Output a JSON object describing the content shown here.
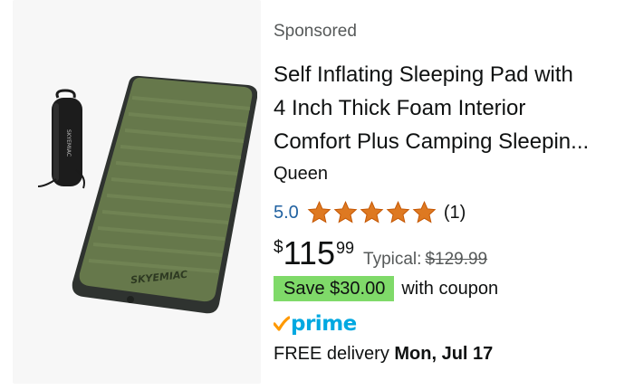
{
  "sponsored_label": "Sponsored",
  "product": {
    "title_lines": [
      "Self Inflating Sleeping Pad with",
      "4 Inch Thick Foam Interior",
      "Comfort Plus Camping Sleepin..."
    ],
    "variant": "Queen",
    "brand_on_product": "SKYEMIAC",
    "image_alt_icon": "sleeping-pad-image"
  },
  "rating": {
    "value": "5.0",
    "stars": 5,
    "count_text": "(1)",
    "star_color": "#de7921"
  },
  "price": {
    "symbol": "$",
    "whole": "115",
    "fraction": "99",
    "typical_label": "Typical:",
    "typical_price": "$129.99"
  },
  "coupon": {
    "badge": "Save $30.00",
    "text": "with coupon",
    "badge_color": "#7fda69"
  },
  "prime": {
    "label": "prime",
    "color": "#00a8e1"
  },
  "delivery": {
    "prefix": "FREE delivery",
    "date": "Mon, Jul 17"
  }
}
